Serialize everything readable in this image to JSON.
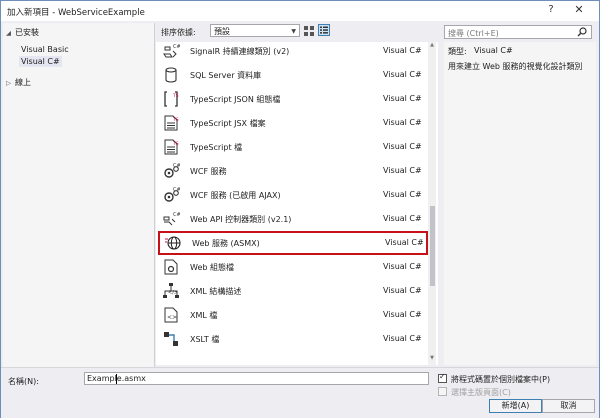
{
  "window": {
    "title": "加入新項目 - WebServiceExample",
    "help": "?",
    "close": "✕"
  },
  "tree": {
    "installed": "已安裝",
    "children": [
      "Visual Basic",
      "Visual C#"
    ],
    "online": "線上"
  },
  "toolbar": {
    "sort_label": "排序依據:",
    "sort_value": "預設"
  },
  "search": {
    "placeholder": "搜尋 (Ctrl+E)"
  },
  "items": [
    {
      "name": "SignalR 持續連線類別 (v2)",
      "lang": "Visual C#",
      "icon": "signalr-class-icon"
    },
    {
      "name": "SQL Server 資料庫",
      "lang": "Visual C#",
      "icon": "database-icon"
    },
    {
      "name": "TypeScript JSON 組態檔",
      "lang": "Visual C#",
      "icon": "json-config-icon"
    },
    {
      "name": "TypeScript JSX 檔案",
      "lang": "Visual C#",
      "icon": "typescript-file-icon"
    },
    {
      "name": "TypeScript 檔",
      "lang": "Visual C#",
      "icon": "typescript-file-icon"
    },
    {
      "name": "WCF 服務",
      "lang": "Visual C#",
      "icon": "wcf-service-icon"
    },
    {
      "name": "WCF 服務 (已啟用 AJAX)",
      "lang": "Visual C#",
      "icon": "wcf-service-icon"
    },
    {
      "name": "Web API 控制器類別 (v2.1)",
      "lang": "Visual C#",
      "icon": "web-api-icon"
    },
    {
      "name": "Web 服務 (ASMX)",
      "lang": "Visual C#",
      "icon": "globe-icon"
    },
    {
      "name": "Web 組態檔",
      "lang": "Visual C#",
      "icon": "config-file-icon"
    },
    {
      "name": "XML 結構描述",
      "lang": "Visual C#",
      "icon": "xml-schema-icon"
    },
    {
      "name": "XML 檔",
      "lang": "Visual C#",
      "icon": "xml-file-icon"
    },
    {
      "name": "XSLT 檔",
      "lang": "Visual C#",
      "icon": "xslt-file-icon"
    }
  ],
  "selected_index": 8,
  "details": {
    "type_label": "類型:",
    "type_value": "Visual C#",
    "description": "用來建立 Web 服務的視覺化設計類別"
  },
  "bottom": {
    "name_label": "名稱(N):",
    "name_value": "Example.asmx",
    "checkbox1_label": "將程式碼置於個別檔案中(P)",
    "checkbox1_checked": true,
    "checkbox2_label": "選擇主版頁面(C)",
    "checkbox2_checked": false,
    "add_button": "新增(A)",
    "cancel_button": "取消"
  }
}
